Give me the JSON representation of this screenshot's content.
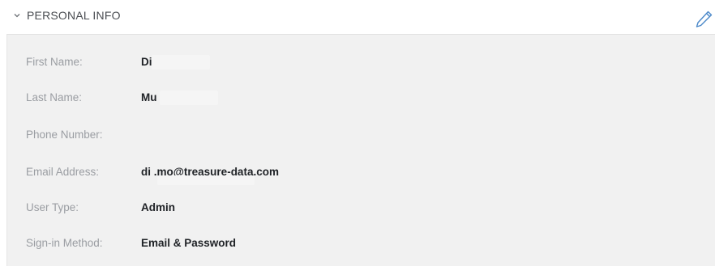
{
  "section": {
    "title": "PERSONAL INFO",
    "chevron_icon": "chevron-down-icon",
    "edit_icon": "pencil-icon",
    "accent_color": "#4a88c9"
  },
  "fields": [
    {
      "label": "First Name:",
      "value": "Di"
    },
    {
      "label": "Last Name:",
      "value": "Mu"
    },
    {
      "label": "Phone Number:",
      "value": ""
    },
    {
      "label": "Email Address:",
      "value": "di                    .mo@treasure-data.com"
    },
    {
      "label": "User Type:",
      "value": "Admin"
    },
    {
      "label": "Sign-in Method:",
      "value": "Email & Password"
    }
  ]
}
